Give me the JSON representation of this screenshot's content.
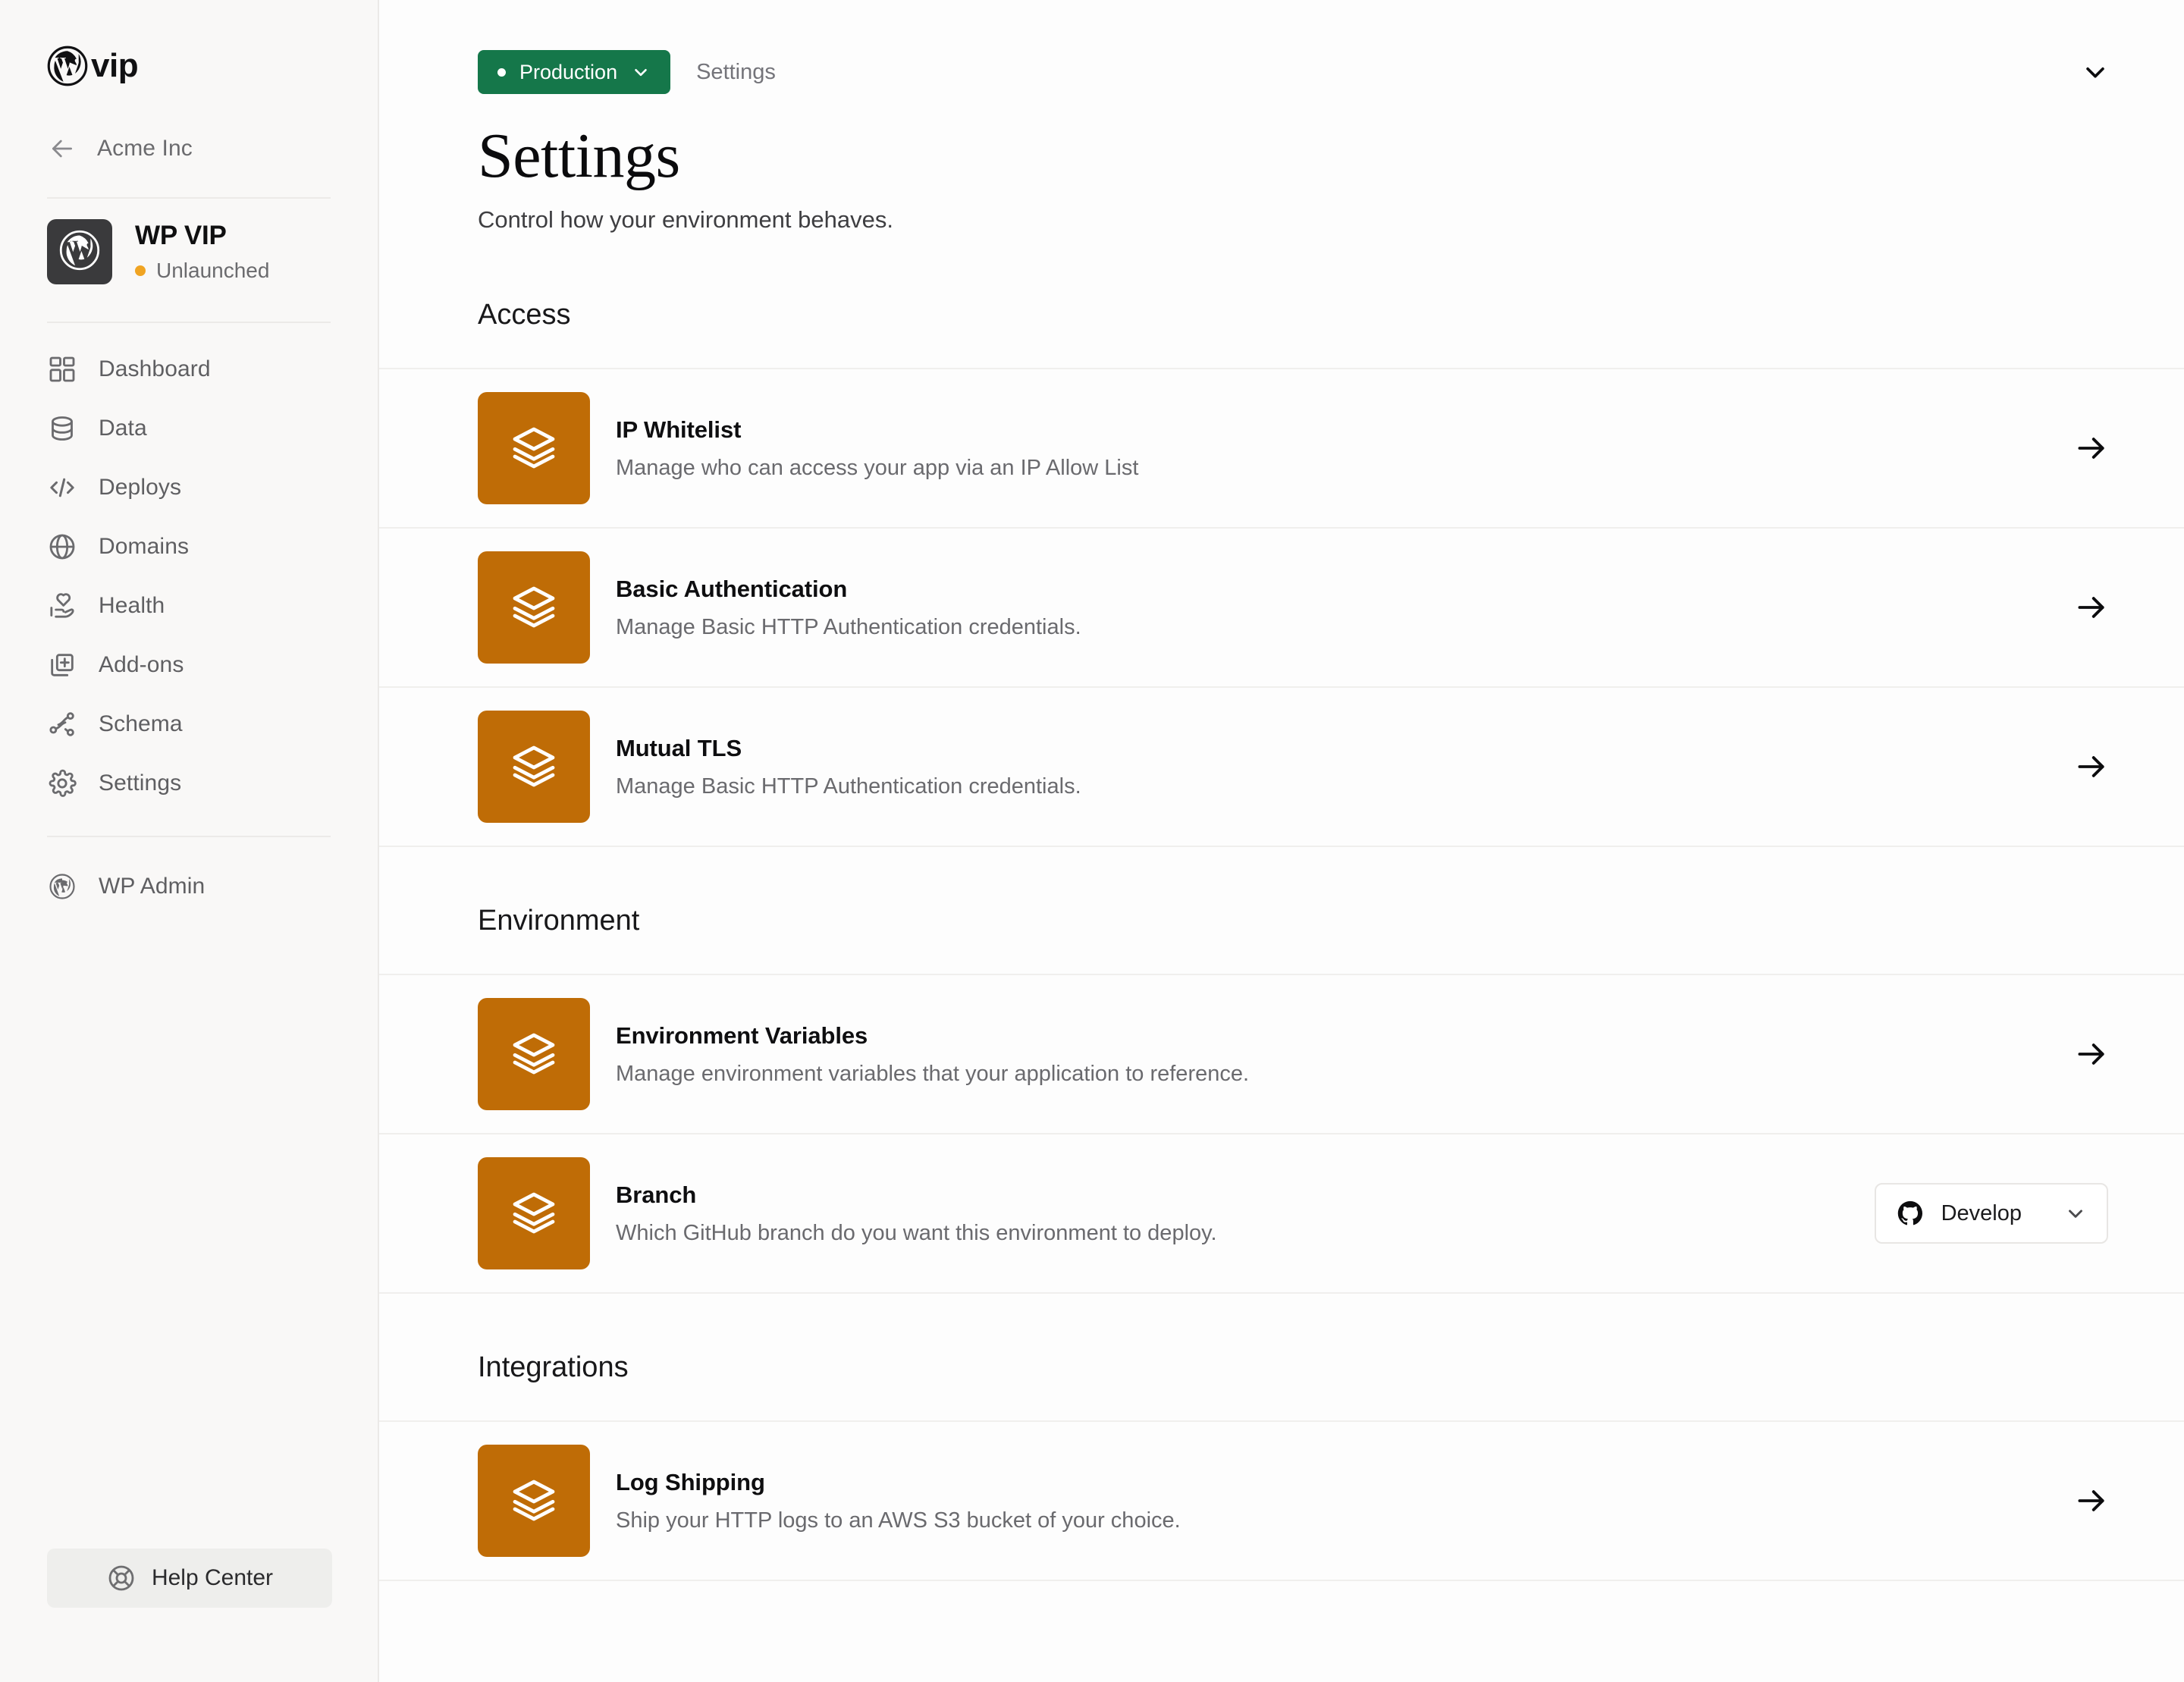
{
  "sidebar": {
    "logo": {
      "text": "vip",
      "icon": "wordpress-logo-icon"
    },
    "org": {
      "name": "Acme Inc",
      "back_icon": "arrow-left-icon"
    },
    "site": {
      "name": "WP VIP",
      "status": "Unlaunched",
      "status_color": "#f0a422",
      "avatar_icon": "wordpress-icon"
    },
    "nav": [
      {
        "label": "Dashboard",
        "icon": "grid-icon"
      },
      {
        "label": "Data",
        "icon": "database-icon"
      },
      {
        "label": "Deploys",
        "icon": "code-icon"
      },
      {
        "label": "Domains",
        "icon": "globe-icon"
      },
      {
        "label": "Health",
        "icon": "hand-heart-icon"
      },
      {
        "label": "Add-ons",
        "icon": "plus-square-stack-icon"
      },
      {
        "label": "Schema",
        "icon": "network-nodes-icon"
      },
      {
        "label": "Settings",
        "icon": "gear-icon"
      }
    ],
    "secondary_nav": [
      {
        "label": "WP Admin",
        "icon": "wordpress-icon"
      }
    ],
    "help": {
      "label": "Help Center",
      "icon": "lifebuoy-icon"
    }
  },
  "header": {
    "environment": {
      "label": "Production",
      "color": "#15774a",
      "chevron_icon": "chevron-down-icon"
    },
    "breadcrumb": "Settings",
    "collapse_icon": "chevron-down-icon"
  },
  "page": {
    "title": "Settings",
    "subtitle": "Control how your environment behaves."
  },
  "sections": [
    {
      "heading": "Access",
      "rows": [
        {
          "title": "IP Whitelist",
          "description": "Manage who can access your app via an IP Allow List",
          "icon": "layers-icon",
          "action": "arrow-right-icon"
        },
        {
          "title": "Basic Authentication",
          "description": "Manage Basic HTTP Authentication credentials.",
          "icon": "layers-icon",
          "action": "arrow-right-icon"
        },
        {
          "title": "Mutual TLS",
          "description": "Manage Basic HTTP Authentication credentials.",
          "icon": "layers-icon",
          "action": "arrow-right-icon"
        }
      ]
    },
    {
      "heading": "Environment",
      "rows": [
        {
          "title": "Environment Variables",
          "description": "Manage environment variables that your application to reference.",
          "icon": "layers-icon",
          "action": "arrow-right-icon"
        },
        {
          "title": "Branch",
          "description": "Which GitHub branch do you want this environment to deploy.",
          "icon": "layers-icon",
          "action": "select",
          "select": {
            "value": "Develop",
            "icon": "github-icon",
            "chevron_icon": "chevron-down-icon"
          }
        }
      ]
    },
    {
      "heading": "Integrations",
      "rows": [
        {
          "title": "Log Shipping",
          "description": "Ship your HTTP logs to an AWS S3 bucket of your choice.",
          "icon": "layers-icon",
          "action": "arrow-right-icon"
        }
      ]
    }
  ],
  "colors": {
    "sidebar_bg": "#f9f8f7",
    "main_bg": "#fdfdfd",
    "tile_orange": "#bf6c06",
    "accent_green": "#15774a",
    "divider": "#f0efed"
  }
}
